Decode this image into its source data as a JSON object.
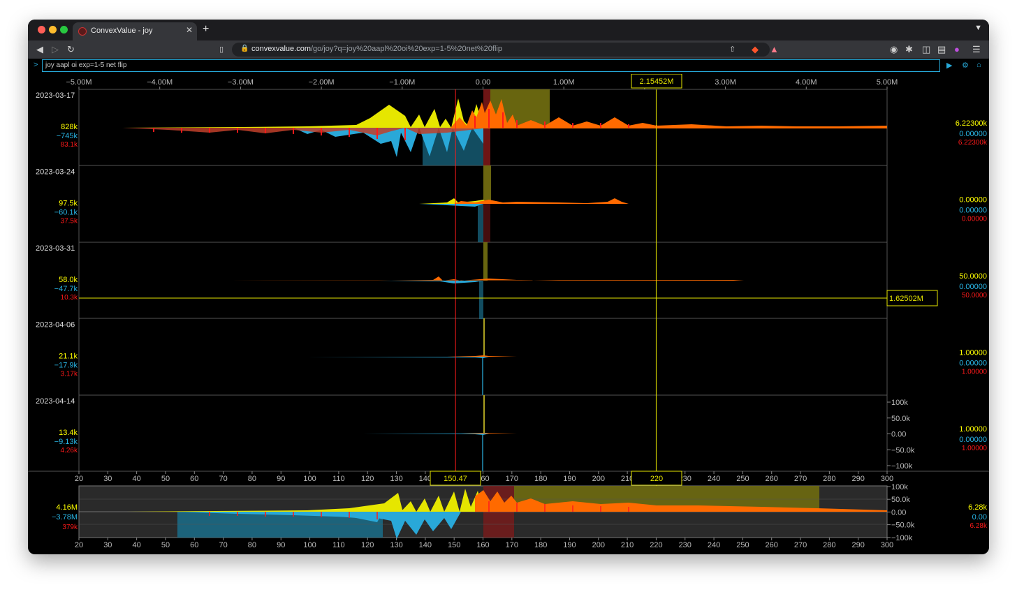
{
  "browser": {
    "tab_title": "ConvexValue - joy",
    "url_domain": "convexvalue.com",
    "url_path": "/go/joy?q=joy%20aapl%20oi%20exp=1-5%20net%20flip",
    "new_tab_label": "+",
    "close_label": "✕"
  },
  "command": {
    "prompt": ">",
    "text": "joy aapl oi exp=1-5 net flip"
  },
  "colors": {
    "yellow": "#ffff00",
    "cyan": "#29b6e6",
    "red": "#ff1a1a",
    "orange": "#ff6a00",
    "accent": "#27a9d8"
  },
  "top_axis": {
    "ticks": [
      "−5.00M",
      "−4.00M",
      "−3.00M",
      "−2.00M",
      "−1.00M",
      "0.00",
      "1.00M",
      "2.00M",
      "3.00M",
      "4.00M",
      "5.00M"
    ],
    "tick_values": [
      -5,
      -4,
      -3,
      -2,
      -1,
      0,
      1,
      2,
      3,
      4,
      5
    ],
    "cursor_label": "2.15452M",
    "cursor_value": 2.15452
  },
  "x_axis": {
    "ticks": [
      "20",
      "30",
      "40",
      "50",
      "60",
      "70",
      "80",
      "90",
      "100",
      "110",
      "120",
      "130",
      "140",
      "150",
      "160",
      "170",
      "180",
      "190",
      "200",
      "210",
      "220",
      "230",
      "240",
      "250",
      "260",
      "270",
      "280",
      "290",
      "300"
    ],
    "tick_values": [
      20,
      30,
      40,
      50,
      60,
      70,
      80,
      90,
      100,
      110,
      120,
      130,
      140,
      150,
      160,
      170,
      180,
      190,
      200,
      210,
      220,
      230,
      240,
      250,
      260,
      270,
      280,
      290,
      300
    ],
    "spot_label": "150.47",
    "spot_value": 150.47,
    "cursor_label": "220",
    "cursor_value": 220
  },
  "panels": [
    {
      "date": "2023-03-17",
      "yellow": "828k",
      "cyan": "−745k",
      "red": "83.1k",
      "r_yellow": "6.22300k",
      "r_cyan": "0.00000",
      "r_red": "6.22300k"
    },
    {
      "date": "2023-03-24",
      "yellow": "97.5k",
      "cyan": "−60.1k",
      "red": "37.5k",
      "r_yellow": "0.00000",
      "r_cyan": "0.00000",
      "r_red": "0.00000"
    },
    {
      "date": "2023-03-31",
      "yellow": "58.0k",
      "cyan": "−47.7k",
      "red": "10.3k",
      "r_yellow": "50.0000",
      "r_cyan": "0.00000",
      "r_red": "50.0000"
    },
    {
      "date": "2023-04-06",
      "yellow": "21.1k",
      "cyan": "−17.9k",
      "red": "3.17k",
      "r_yellow": "1.00000",
      "r_cyan": "0.00000",
      "r_red": "1.00000"
    },
    {
      "date": "2023-04-14",
      "yellow": "13.4k",
      "cyan": "−9.13k",
      "red": "4.26k",
      "r_yellow": "1.00000",
      "r_cyan": "0.00000",
      "r_red": "1.00000"
    }
  ],
  "crosshair_label": "1.62502M",
  "crosshair_value": 1.62502,
  "panel5_y_ticks": [
    "100k",
    "50.0k",
    "0.00",
    "−50.0k",
    "−100k"
  ],
  "summary": {
    "yellow": "4.16M",
    "cyan": "−3.78M",
    "red": "379k",
    "r_yellow": "6.28k",
    "r_cyan": "0.00",
    "r_red": "6.28k",
    "y_ticks": [
      "100k",
      "50.0k",
      "0.00",
      "−50.0k",
      "−100k"
    ]
  },
  "chart_data": {
    "type": "area",
    "x_range": [
      20,
      300
    ],
    "y_range_top_axis": [
      -5,
      5
    ],
    "series": [
      {
        "name": "yellow",
        "x": [
          130,
          135,
          140,
          145,
          150,
          155,
          160,
          165,
          170,
          180,
          190,
          200
        ],
        "values": [
          80,
          40,
          60,
          50,
          120,
          110,
          90,
          60,
          40,
          30,
          20,
          15
        ]
      },
      {
        "name": "cyan",
        "x": [
          55,
          70,
          90,
          110,
          126,
          130,
          135,
          140,
          145,
          150,
          155,
          160
        ],
        "values": [
          -20,
          -15,
          -20,
          -25,
          -35,
          -90,
          -60,
          -70,
          -50,
          -40,
          -45,
          -30
        ]
      }
    ]
  }
}
